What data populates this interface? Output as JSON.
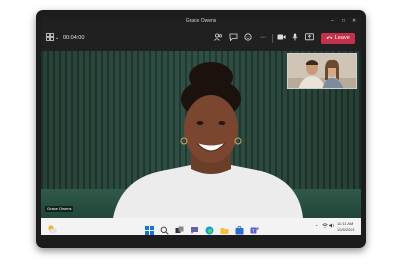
{
  "window": {
    "title": "Grace Owens",
    "controls": [
      "–",
      "□",
      "✕"
    ]
  },
  "toolbar": {
    "timer": "00:04:00",
    "leave_label": "Leave",
    "icons": [
      "people-icon",
      "chat-icon",
      "reactions-icon",
      "more-icon",
      "camera-icon",
      "mic-icon",
      "share-icon"
    ]
  },
  "video": {
    "participant_name": "Grace Owens"
  },
  "taskbar": {
    "apps": [
      "start-icon",
      "search-icon",
      "task-view-icon",
      "chat-icon",
      "edge-icon",
      "file-explorer-icon",
      "store-icon",
      "teams-icon"
    ],
    "clock": "11:11 AM",
    "date": "10/5/2021"
  },
  "colors": {
    "leave": "#c4314b",
    "toolbar": "#202020",
    "wall": "#29493d",
    "taskbar": "#f3f3f3"
  }
}
